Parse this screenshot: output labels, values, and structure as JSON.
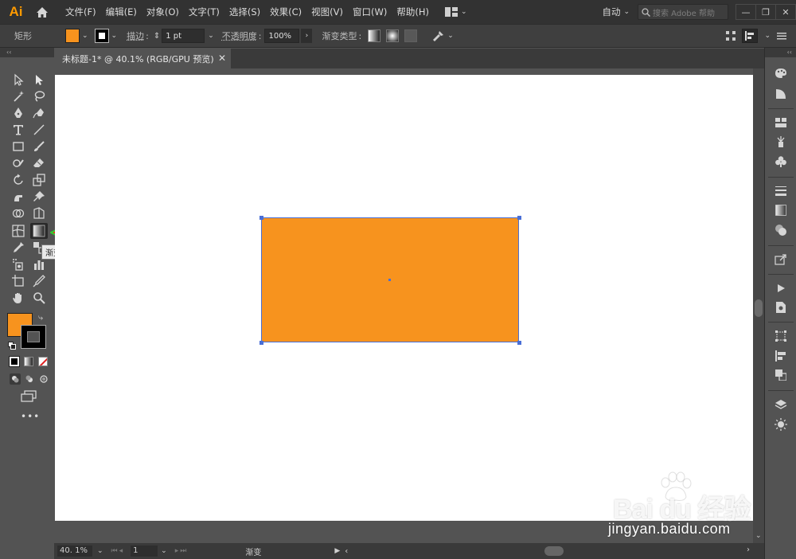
{
  "app": {
    "logo_text": "Ai",
    "menus": [
      "文件(F)",
      "编辑(E)",
      "对象(O)",
      "文字(T)",
      "选择(S)",
      "效果(C)",
      "视图(V)",
      "窗口(W)",
      "帮助(H)"
    ],
    "workspace_label": "自动",
    "search_placeholder": "搜索 Adobe 帮助",
    "window_buttons": [
      "—",
      "❐",
      "✕"
    ]
  },
  "control_bar": {
    "object_type": "矩形",
    "fill_color": "#f7931e",
    "stroke_label": "描边",
    "stroke_value": "1 pt",
    "opacity_label": "不透明度",
    "opacity_value": "100%",
    "gradient_type_label": "渐变类型"
  },
  "document": {
    "tab_title": "未标题-1* @ 40.1% (RGB/GPU 预览)",
    "tab_close": "✕",
    "rectangle_fill": "#f7931e",
    "selection_color": "#4a6fd6"
  },
  "toolbar": {
    "tooltip": "渐变工具 (G)",
    "fill_color": "#f7931e",
    "stroke_color": "#000000",
    "more_tools": "•••"
  },
  "status_bar": {
    "zoom": "40. 1%",
    "artboard_number": "1",
    "current_tool": "渐变"
  },
  "watermark": {
    "brand": "Bai du 经验",
    "url": "jingyan.baidu.com"
  }
}
